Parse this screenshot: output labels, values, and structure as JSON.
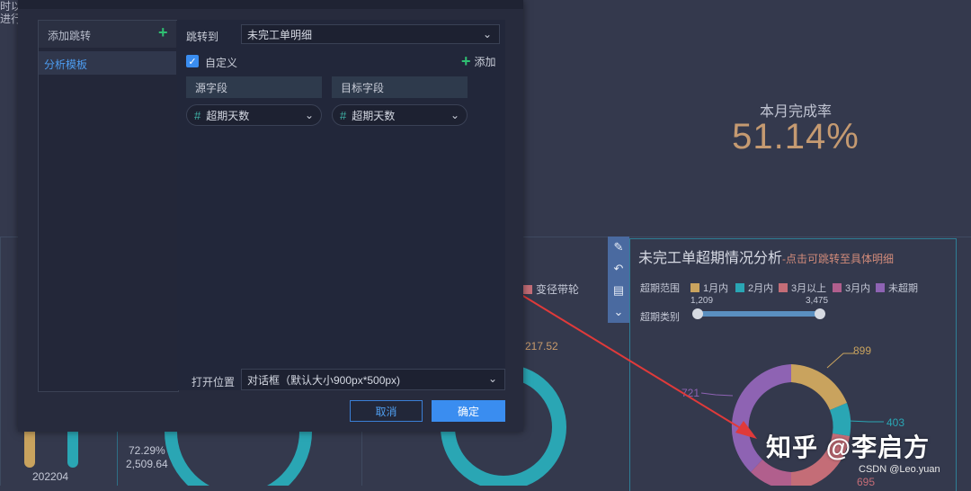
{
  "background": {
    "top_left_text": [
      "时以",
      "进行"
    ],
    "completion_rate_label": "本月完成率",
    "completion_rate_value": "51.14%",
    "bg_legend_label": "变径带轮",
    "bg_value_1": "217.52",
    "bg_percent": "72.29%",
    "bg_amount": "2,509.64",
    "bg_period": "202204"
  },
  "chart": {
    "title": "未完工单超期情况分析",
    "subtitle": "-点击可跳转至具体明细",
    "range_label": "超期范围",
    "legend": [
      {
        "label": "1月内",
        "color": "#c9a35e"
      },
      {
        "label": "2月内",
        "color": "#2aa6b4"
      },
      {
        "label": "3月以上",
        "color": "#c46d77"
      },
      {
        "label": "3月内",
        "color": "#b15f8d"
      },
      {
        "label": "未超期",
        "color": "#8e63b3"
      }
    ],
    "category_label": "超期类别",
    "slider_min": "1,209",
    "slider_max": "3,475",
    "annotations": {
      "a": "899",
      "b": "403",
      "c": "721",
      "d": "695"
    }
  },
  "toolbar_icons": [
    "edit-icon",
    "undo-icon",
    "comment-icon",
    "collapse-icon"
  ],
  "modal": {
    "left_header": "添加跳转",
    "left_items": [
      "分析模板"
    ],
    "jump_to_label": "跳转到",
    "jump_to_value": "未完工单明细",
    "custom_label": "自定义",
    "add_label": "添加",
    "source_field_header": "源字段",
    "target_field_header": "目标字段",
    "source_field_value": "超期天数",
    "target_field_value": "超期天数",
    "open_position_label": "打开位置",
    "open_position_value": "对话框（默认大小900px*500px)",
    "cancel_label": "取消",
    "ok_label": "确定"
  },
  "watermark": "知乎 @李启方",
  "csdn": "CSDN @Leo.yuan",
  "colors": {
    "accent": "#3a8df0",
    "arrow": "#e03a3a",
    "rate": "#c59a71"
  }
}
